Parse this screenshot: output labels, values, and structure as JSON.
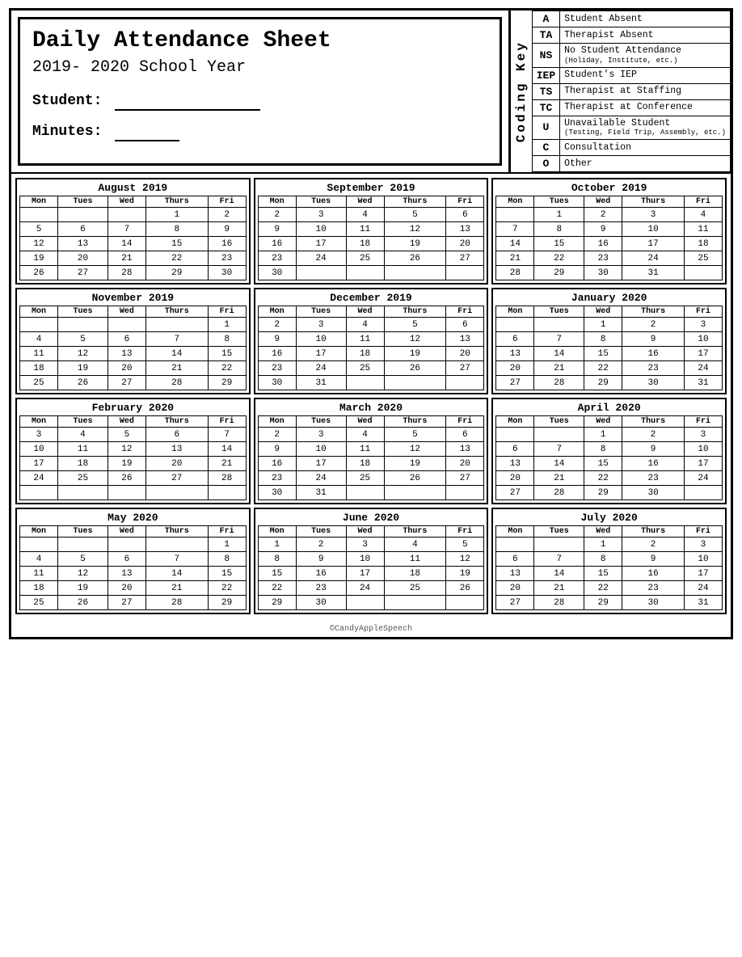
{
  "header": {
    "title": "Daily Attendance Sheet",
    "school_year": "2019- 2020 School Year",
    "student_label": "Student:",
    "minutes_label": "Minutes:",
    "coding_key_label": "Coding Key"
  },
  "coding_key": [
    {
      "code": "A",
      "description": "Student Absent",
      "note": ""
    },
    {
      "code": "TA",
      "description": "Therapist Absent",
      "note": ""
    },
    {
      "code": "NS",
      "description": "No Student Attendance",
      "note": "(Holiday, Institute, etc.)"
    },
    {
      "code": "IEP",
      "description": "Student's IEP",
      "note": ""
    },
    {
      "code": "TS",
      "description": "Therapist at Staffing",
      "note": ""
    },
    {
      "code": "TC",
      "description": "Therapist at Conference",
      "note": ""
    },
    {
      "code": "U",
      "description": "Unavailable Student",
      "note": "(Testing, Field Trip, Assembly, etc.)"
    },
    {
      "code": "C",
      "description": "Consultation",
      "note": ""
    },
    {
      "code": "O",
      "description": "Other",
      "note": ""
    }
  ],
  "calendars": [
    {
      "month": "August 2019",
      "days": [
        "Mon",
        "Tues",
        "Wed",
        "Thurs",
        "Fri"
      ],
      "weeks": [
        [
          "",
          "",
          "",
          "1",
          "2"
        ],
        [
          "5",
          "6",
          "7",
          "8",
          "9"
        ],
        [
          "12",
          "13",
          "14",
          "15",
          "16"
        ],
        [
          "19",
          "20",
          "21",
          "22",
          "23"
        ],
        [
          "26",
          "27",
          "28",
          "29",
          "30"
        ]
      ]
    },
    {
      "month": "September 2019",
      "days": [
        "Mon",
        "Tues",
        "Wed",
        "Thurs",
        "Fri"
      ],
      "weeks": [
        [
          "2",
          "3",
          "4",
          "5",
          "6"
        ],
        [
          "9",
          "10",
          "11",
          "12",
          "13"
        ],
        [
          "16",
          "17",
          "18",
          "19",
          "20"
        ],
        [
          "23",
          "24",
          "25",
          "26",
          "27"
        ],
        [
          "30",
          "",
          "",
          "",
          ""
        ]
      ]
    },
    {
      "month": "October 2019",
      "days": [
        "Mon",
        "Tues",
        "Wed",
        "Thurs",
        "Fri"
      ],
      "weeks": [
        [
          "",
          "1",
          "2",
          "3",
          "4"
        ],
        [
          "7",
          "8",
          "9",
          "10",
          "11"
        ],
        [
          "14",
          "15",
          "16",
          "17",
          "18"
        ],
        [
          "21",
          "22",
          "23",
          "24",
          "25"
        ],
        [
          "28",
          "29",
          "30",
          "31",
          ""
        ]
      ]
    },
    {
      "month": "November 2019",
      "days": [
        "Mon",
        "Tues",
        "Wed",
        "Thurs",
        "Fri"
      ],
      "weeks": [
        [
          "",
          "",
          "",
          "",
          "1"
        ],
        [
          "4",
          "5",
          "6",
          "7",
          "8"
        ],
        [
          "11",
          "12",
          "13",
          "14",
          "15"
        ],
        [
          "18",
          "19",
          "20",
          "21",
          "22"
        ],
        [
          "25",
          "26",
          "27",
          "28",
          "29"
        ]
      ]
    },
    {
      "month": "December 2019",
      "days": [
        "Mon",
        "Tues",
        "Wed",
        "Thurs",
        "Fri"
      ],
      "weeks": [
        [
          "2",
          "3",
          "4",
          "5",
          "6"
        ],
        [
          "9",
          "10",
          "11",
          "12",
          "13"
        ],
        [
          "16",
          "17",
          "18",
          "19",
          "20"
        ],
        [
          "23",
          "24",
          "25",
          "26",
          "27"
        ],
        [
          "30",
          "31",
          "",
          "",
          ""
        ]
      ]
    },
    {
      "month": "January 2020",
      "days": [
        "Mon",
        "Tues",
        "Wed",
        "Thurs",
        "Fri"
      ],
      "weeks": [
        [
          "",
          "",
          "1",
          "2",
          "3"
        ],
        [
          "6",
          "7",
          "8",
          "9",
          "10"
        ],
        [
          "13",
          "14",
          "15",
          "16",
          "17"
        ],
        [
          "20",
          "21",
          "22",
          "23",
          "24"
        ],
        [
          "27",
          "28",
          "29",
          "30",
          "31"
        ]
      ]
    },
    {
      "month": "February 2020",
      "days": [
        "Mon",
        "Tues",
        "Wed",
        "Thurs",
        "Fri"
      ],
      "weeks": [
        [
          "3",
          "4",
          "5",
          "6",
          "7"
        ],
        [
          "10",
          "11",
          "12",
          "13",
          "14"
        ],
        [
          "17",
          "18",
          "19",
          "20",
          "21"
        ],
        [
          "24",
          "25",
          "26",
          "27",
          "28"
        ],
        [
          "",
          "",
          "",
          "",
          ""
        ]
      ]
    },
    {
      "month": "March 2020",
      "days": [
        "Mon",
        "Tues",
        "Wed",
        "Thurs",
        "Fri"
      ],
      "weeks": [
        [
          "2",
          "3",
          "4",
          "5",
          "6"
        ],
        [
          "9",
          "10",
          "11",
          "12",
          "13"
        ],
        [
          "16",
          "17",
          "18",
          "19",
          "20"
        ],
        [
          "23",
          "24",
          "25",
          "26",
          "27"
        ],
        [
          "30",
          "31",
          "",
          "",
          ""
        ]
      ]
    },
    {
      "month": "April 2020",
      "days": [
        "Mon",
        "Tues",
        "Wed",
        "Thurs",
        "Fri"
      ],
      "weeks": [
        [
          "",
          "",
          "1",
          "2",
          "3"
        ],
        [
          "6",
          "7",
          "8",
          "9",
          "10"
        ],
        [
          "13",
          "14",
          "15",
          "16",
          "17"
        ],
        [
          "20",
          "21",
          "22",
          "23",
          "24"
        ],
        [
          "27",
          "28",
          "29",
          "30",
          ""
        ]
      ]
    },
    {
      "month": "May 2020",
      "days": [
        "Mon",
        "Tues",
        "Wed",
        "Thurs",
        "Fri"
      ],
      "weeks": [
        [
          "",
          "",
          "",
          "",
          "1"
        ],
        [
          "4",
          "5",
          "6",
          "7",
          "8"
        ],
        [
          "11",
          "12",
          "13",
          "14",
          "15"
        ],
        [
          "18",
          "19",
          "20",
          "21",
          "22"
        ],
        [
          "25",
          "26",
          "27",
          "28",
          "29"
        ]
      ]
    },
    {
      "month": "June 2020",
      "days": [
        "Mon",
        "Tues",
        "Wed",
        "Thurs",
        "Fri"
      ],
      "weeks": [
        [
          "1",
          "2",
          "3",
          "4",
          "5"
        ],
        [
          "8",
          "9",
          "10",
          "11",
          "12"
        ],
        [
          "15",
          "16",
          "17",
          "18",
          "19"
        ],
        [
          "22",
          "23",
          "24",
          "25",
          "26"
        ],
        [
          "29",
          "30",
          "",
          "",
          ""
        ]
      ]
    },
    {
      "month": "July 2020",
      "days": [
        "Mon",
        "Tues",
        "Wed",
        "Thurs",
        "Fri"
      ],
      "weeks": [
        [
          "",
          "",
          "1",
          "2",
          "3"
        ],
        [
          "6",
          "7",
          "8",
          "9",
          "10"
        ],
        [
          "13",
          "14",
          "15",
          "16",
          "17"
        ],
        [
          "20",
          "21",
          "22",
          "23",
          "24"
        ],
        [
          "27",
          "28",
          "29",
          "30",
          "31"
        ]
      ]
    }
  ],
  "footer": "©CandyAppleSpeech"
}
